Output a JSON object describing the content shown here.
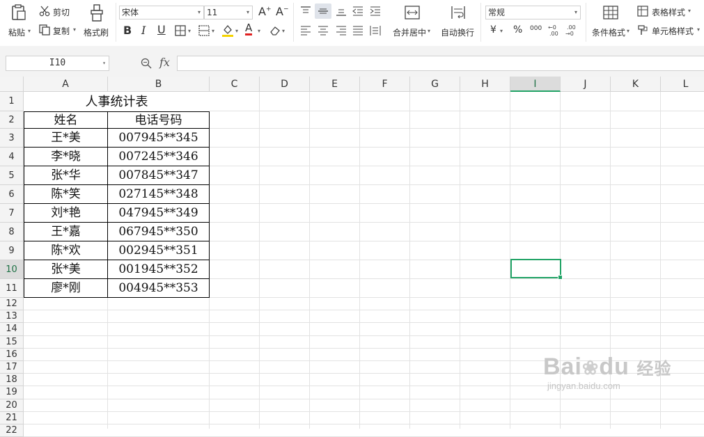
{
  "ribbon": {
    "paste": "粘贴",
    "cut": "剪切",
    "copy": "复制",
    "format_painter": "格式刷",
    "font_name": "宋体",
    "font_size": "11",
    "merge_center": "合并居中",
    "wrap_text": "自动换行",
    "number_format": "常规",
    "conditional_format": "条件格式",
    "table_style": "表格样式",
    "cell_style": "单元格样式",
    "currency_symbol": "¥",
    "percent_symbol": "%",
    "thousands_symbol": "000"
  },
  "formula_bar": {
    "cell_ref": "I10",
    "fx": "fx",
    "value": ""
  },
  "sheet": {
    "columns": [
      "A",
      "B",
      "C",
      "D",
      "E",
      "F",
      "G",
      "H",
      "I",
      "J",
      "K",
      "L"
    ],
    "rows": [
      "1",
      "2",
      "3",
      "4",
      "5",
      "6",
      "7",
      "8",
      "9",
      "10",
      "11",
      "12",
      "13",
      "14",
      "15",
      "16",
      "17",
      "18",
      "19",
      "20",
      "21",
      "22"
    ],
    "selected_column": "I",
    "selected_row": "10",
    "title": "人事统计表",
    "headers": [
      "姓名",
      "电话号码"
    ],
    "records": [
      [
        "王*美",
        "007945**345"
      ],
      [
        "李*晓",
        "007245**346"
      ],
      [
        "张*华",
        "007845**347"
      ],
      [
        "陈*笑",
        "027145**348"
      ],
      [
        "刘*艳",
        "047945**349"
      ],
      [
        "王*嘉",
        "067945**350"
      ],
      [
        "陈*欢",
        "002945**351"
      ],
      [
        "张*美",
        "001945**352"
      ],
      [
        "廖*刚",
        "004945**353"
      ]
    ]
  },
  "watermark": {
    "brand": "Bai",
    "brand2": "du",
    "product": "经验",
    "url": "jingyan.baidu.com"
  }
}
